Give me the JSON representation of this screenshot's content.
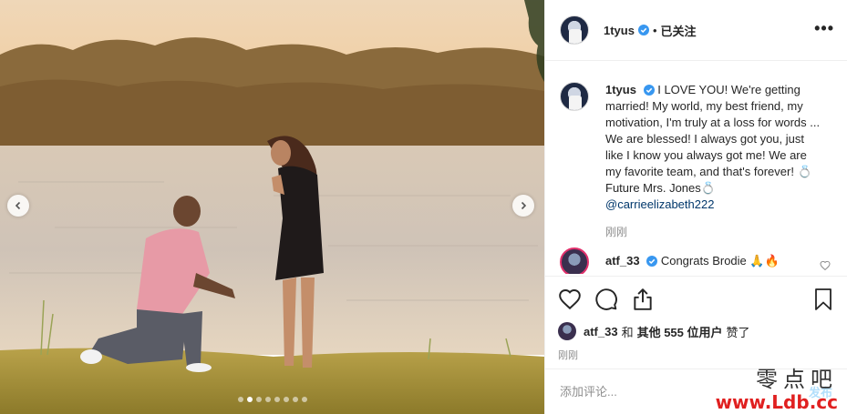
{
  "post": {
    "username": "1tyus",
    "separator": "•",
    "follow_state": "已关注",
    "more_label": "•••",
    "caption_prefix": "I LOVE YOU! We're getting married! My world, my best friend, my motivation, I'm truly at a loss for words ... We are blessed! I always got you, just like I know you always got me! We are my favorite team, and that's forever! 💍Future Mrs. Jones💍",
    "caption_mention": "@carrieelizabeth222",
    "caption_time": "刚刚",
    "slide_count": 8,
    "active_slide": 2
  },
  "comment": {
    "username": "atf_33",
    "text": "Congrats Brodie 🙏🔥"
  },
  "likes": {
    "username": "atf_33",
    "connector": "和",
    "others": "其他 555 位用户",
    "suffix": "赞了"
  },
  "timestamp": "刚刚",
  "add_comment": {
    "placeholder": "添加评论...",
    "post_label": "发布"
  },
  "watermark": {
    "line1": "零点吧",
    "line2": "www.Ldb.cc"
  },
  "colors": {
    "verified": "#3897f0",
    "link": "#00376b",
    "watermark_red": "#e02020"
  }
}
